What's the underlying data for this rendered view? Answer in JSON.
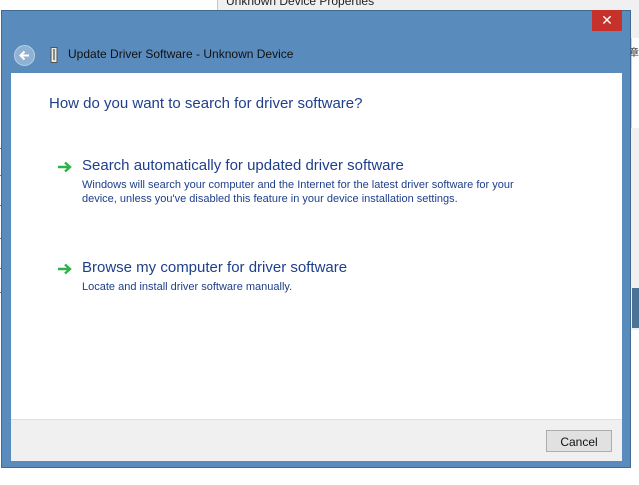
{
  "background_window": {
    "title": "Unknown Device Properties",
    "glyph": "章"
  },
  "dialog": {
    "title": "Update Driver Software - Unknown Device",
    "close_label": "✕",
    "heading": "How do you want to search for driver software?",
    "options": [
      {
        "title": "Search automatically for updated driver software",
        "description": "Windows will search your computer and the Internet for the latest driver software for your device, unless you've disabled this feature in your device installation settings."
      },
      {
        "title": "Browse my computer for driver software",
        "description": "Locate and install driver software manually."
      }
    ],
    "cancel_label": "Cancel"
  },
  "colors": {
    "frame": "#5a8bbd",
    "close": "#c7312b",
    "link_text": "#1e3f8a",
    "arrow": "#2db34a"
  },
  "icons": {
    "back": "back-arrow-icon",
    "device": "device-icon",
    "option_arrow": "green-arrow-icon"
  }
}
